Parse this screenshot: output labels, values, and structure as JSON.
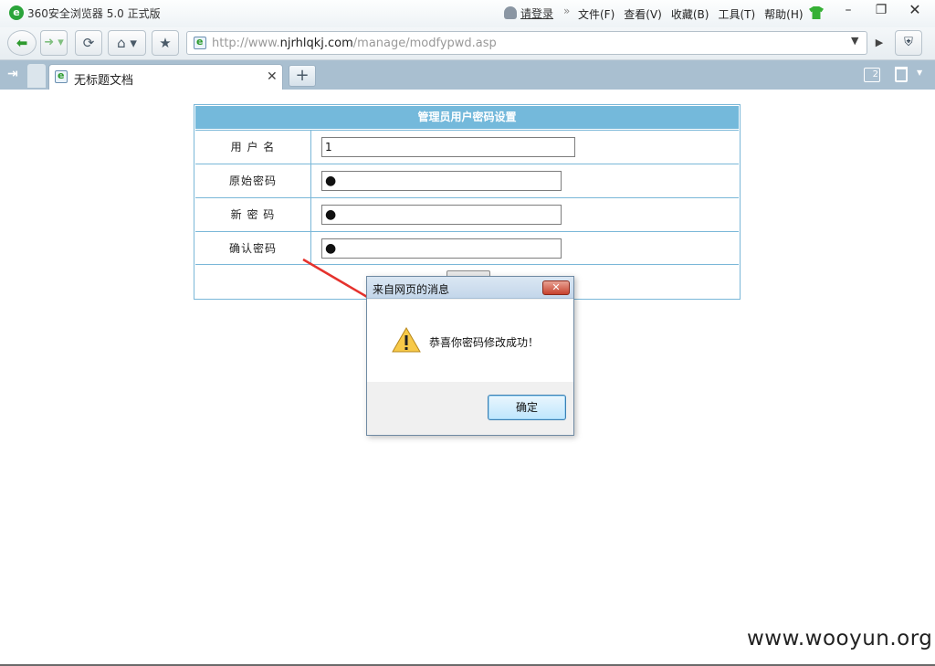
{
  "browser": {
    "title": "360安全浏览器 5.0 正式版",
    "login_label": "请登录",
    "menu_separator": "»",
    "menu": [
      "文件(F)",
      "查看(V)",
      "收藏(B)",
      "工具(T)",
      "帮助(H)"
    ],
    "window_buttons": {
      "minimize": "–",
      "restore": "❐",
      "close": "✕"
    }
  },
  "nav": {
    "url_prefix": "http://www.",
    "url_host": "njrhlqkj.com",
    "url_path": "/manage/modfypwd.asp"
  },
  "tabs": {
    "active_title": "无标题文档",
    "tab_count": "2"
  },
  "form": {
    "header": "管理员用户密码设置",
    "rows": [
      {
        "label": "用 户 名",
        "value": "1"
      },
      {
        "label": "原始密码",
        "value": "●"
      },
      {
        "label": "新 密 码",
        "value": "●"
      },
      {
        "label": "确认密码",
        "value": "●"
      }
    ]
  },
  "dialog": {
    "title": "来自网页的消息",
    "message": "恭喜你密码修改成功！",
    "ok_label": "确定",
    "icon": "warning-icon"
  },
  "watermark": "www.wooyun.org",
  "colors": {
    "form_header": "#74b9db",
    "tabbar": "#a9bfd0",
    "arrow": "#e5322d"
  }
}
